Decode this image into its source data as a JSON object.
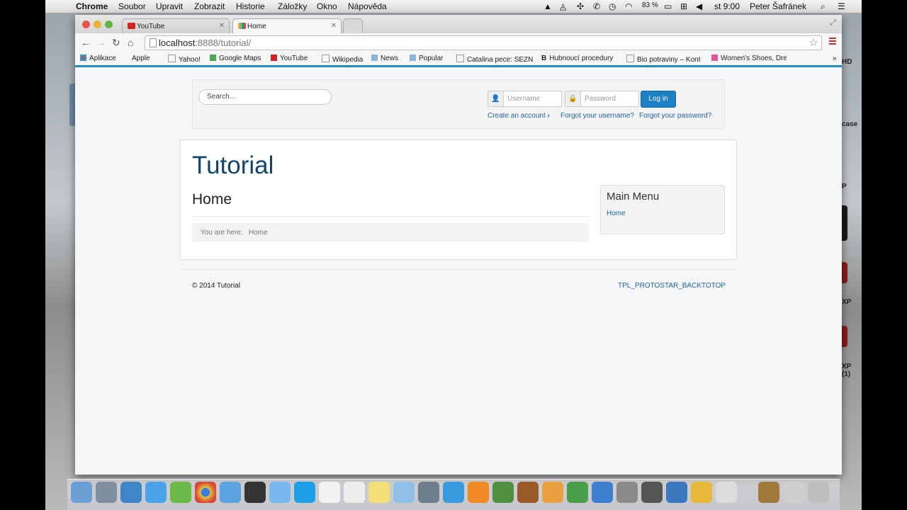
{
  "menubar": {
    "app": "Chrome",
    "items": [
      "Soubor",
      "Upravit",
      "Zobrazit",
      "Historie",
      "Záložky",
      "Okno",
      "Nápověda"
    ],
    "battery": "83 %",
    "clock": "st 9:00",
    "user": "Peter Šafránek"
  },
  "tabs": [
    {
      "label": "YouTube"
    },
    {
      "label": "Home"
    }
  ],
  "address": {
    "host": "localhost",
    "rest": ":8888/tutorial/"
  },
  "bookmarks": [
    "Aplikace",
    "Apple",
    "Yahoo!",
    "Google Maps",
    "YouTube",
    "Wikipedia",
    "News",
    "Popular",
    "Catalina pece: SEZNA",
    "Hubnoucí procedury",
    "Bio potraviny – Kont",
    "Women's Shoes, Dre"
  ],
  "page": {
    "search_placeholder": "Search...",
    "username_placeholder": "Username",
    "password_placeholder": "Password",
    "login_label": "Log in",
    "create_account": "Create an account",
    "forgot_username": "Forgot your username?",
    "forgot_password": "Forgot your password?",
    "brand": "Tutorial",
    "title": "Home",
    "breadcrumb_prefix": "You are here:",
    "breadcrumb_item": "Home",
    "menu_title": "Main Menu",
    "menu_item": "Home",
    "copyright": "© 2014 Tutorial",
    "back_to_top": "TPL_PROTOSTAR_BACKTOTOP"
  },
  "desktop_labels": [
    "HD",
    "case",
    "P",
    "XP",
    "XP (1)"
  ],
  "colors": {
    "accent": "#1d7fc4",
    "brand": "#11456b",
    "link": "#1f63a8"
  }
}
